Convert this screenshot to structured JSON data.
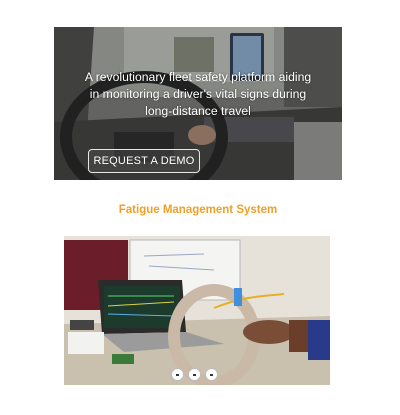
{
  "hero": {
    "tagline": "A revolutionary fleet safety platform aiding in monitoring a driver's vital signs during long-distance travel",
    "cta_label": "REQUEST A DEMO"
  },
  "section": {
    "title": "Fatigue Management System"
  },
  "carousel": {
    "slide_count": 3
  },
  "colors": {
    "accent": "#f0a028",
    "hero_text": "#ffffff"
  }
}
